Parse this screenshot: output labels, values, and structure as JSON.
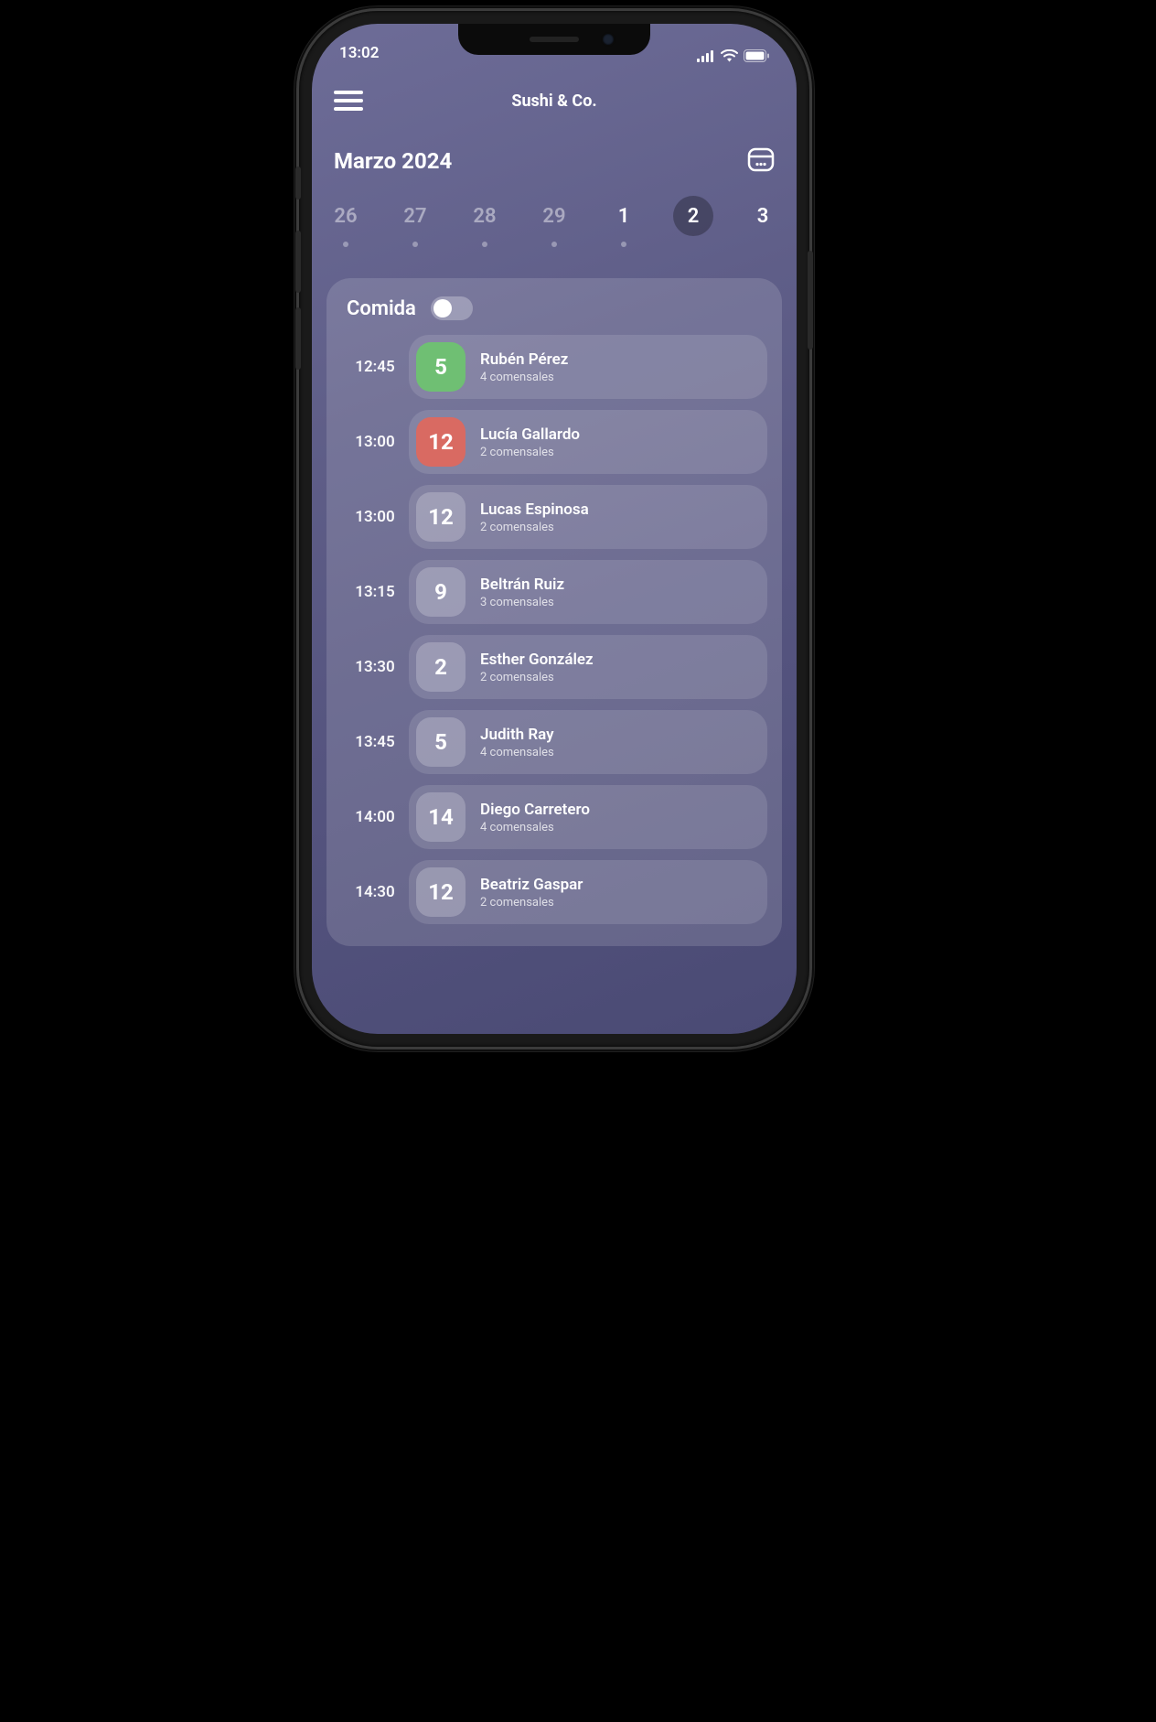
{
  "status": {
    "time": "13:02"
  },
  "header": {
    "title": "Sushi & Co."
  },
  "month": {
    "label": "Marzo 2024"
  },
  "days": [
    {
      "num": "26",
      "muted": true,
      "dot": true,
      "selected": false
    },
    {
      "num": "27",
      "muted": true,
      "dot": true,
      "selected": false
    },
    {
      "num": "28",
      "muted": true,
      "dot": true,
      "selected": false
    },
    {
      "num": "29",
      "muted": true,
      "dot": true,
      "selected": false
    },
    {
      "num": "1",
      "muted": false,
      "dot": true,
      "selected": false
    },
    {
      "num": "2",
      "muted": false,
      "dot": false,
      "selected": true
    },
    {
      "num": "3",
      "muted": false,
      "dot": false,
      "selected": false
    }
  ],
  "card": {
    "title": "Comida",
    "reservations": [
      {
        "time": "12:45",
        "table": "5",
        "name": "Rubén Pérez",
        "sub": "4 comensales",
        "color": "green"
      },
      {
        "time": "13:00",
        "table": "12",
        "name": "Lucía Gallardo",
        "sub": "2 comensales",
        "color": "red"
      },
      {
        "time": "13:00",
        "table": "12",
        "name": "Lucas Espinosa",
        "sub": "2 comensales",
        "color": ""
      },
      {
        "time": "13:15",
        "table": "9",
        "name": "Beltrán Ruiz",
        "sub": "3 comensales",
        "color": ""
      },
      {
        "time": "13:30",
        "table": "2",
        "name": "Esther González",
        "sub": "2 comensales",
        "color": ""
      },
      {
        "time": "13:45",
        "table": "5",
        "name": "Judith Ray",
        "sub": "4 comensales",
        "color": ""
      },
      {
        "time": "14:00",
        "table": "14",
        "name": "Diego Carretero",
        "sub": "4 comensales",
        "color": ""
      },
      {
        "time": "14:30",
        "table": "12",
        "name": "Beatriz Gaspar",
        "sub": "2 comensales",
        "color": ""
      }
    ]
  }
}
